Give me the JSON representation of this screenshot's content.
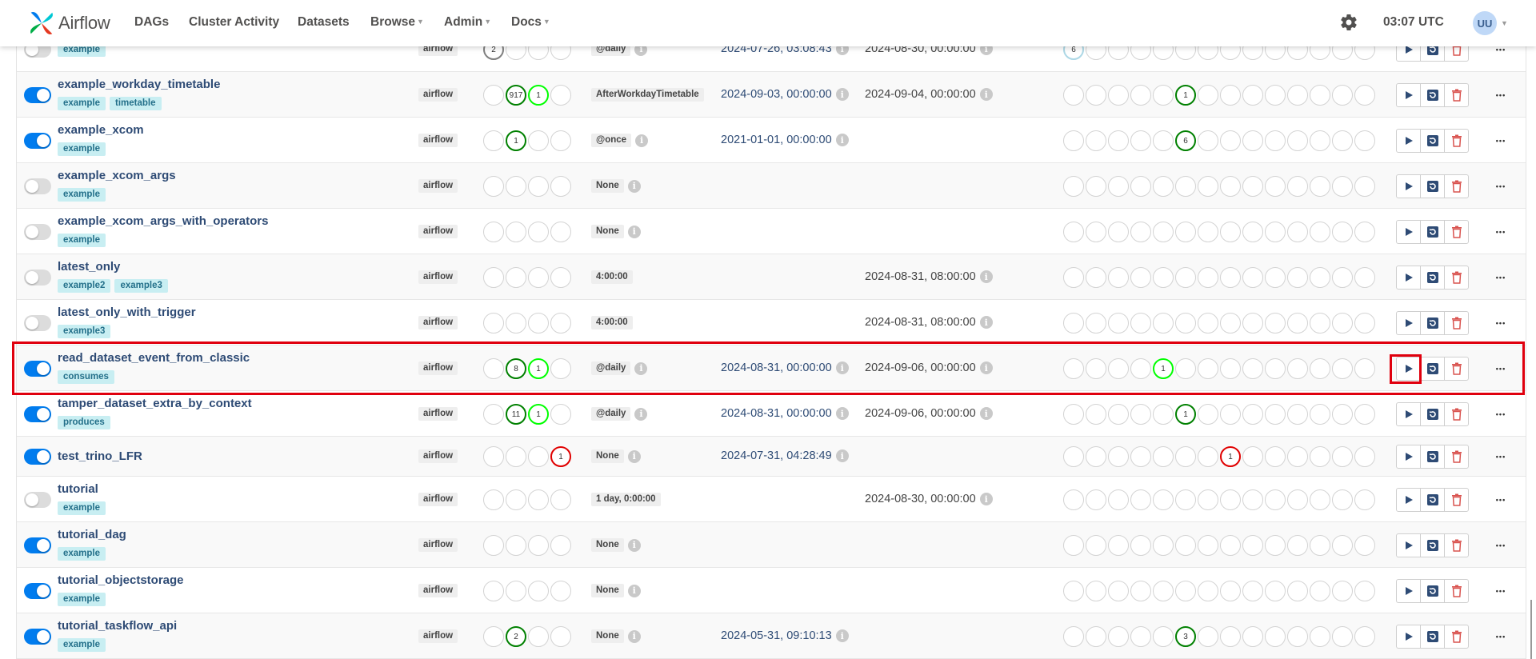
{
  "nav": {
    "brand": "Airflow",
    "items": [
      "DAGs",
      "Cluster Activity",
      "Datasets",
      "Browse",
      "Admin",
      "Docs"
    ],
    "time": "03:07 UTC",
    "user_initials": "UU"
  },
  "rows": [
    {
      "name": "",
      "tags": [
        "example"
      ],
      "owner": "airflow",
      "paused": true,
      "task_stats": [
        {
          "n": "2",
          "s": "queued"
        },
        {
          "n": "",
          "s": ""
        },
        {
          "n": "",
          "s": ""
        },
        {
          "n": "",
          "s": ""
        }
      ],
      "schedule": "@daily",
      "schedule_info": true,
      "last_run": "2024-07-26, 03:08:43",
      "next_run": "2024-08-30, 00:00:00",
      "runs": [
        {
          "n": "6",
          "s": "scheduled"
        }
      ]
    },
    {
      "name": "example_workday_timetable",
      "tags": [
        "example",
        "timetable"
      ],
      "owner": "airflow",
      "paused": false,
      "task_stats": [
        {
          "n": "",
          "s": ""
        },
        {
          "n": "917",
          "s": "success"
        },
        {
          "n": "1",
          "s": "running"
        },
        {
          "n": "",
          "s": ""
        }
      ],
      "schedule": "AfterWorkdayTimetable",
      "schedule_info": false,
      "last_run": "2024-09-03, 00:00:00",
      "next_run": "2024-09-04, 00:00:00",
      "runs": [
        {
          "n": "",
          "s": ""
        },
        {
          "n": "",
          "s": ""
        },
        {
          "n": "",
          "s": ""
        },
        {
          "n": "",
          "s": ""
        },
        {
          "n": "",
          "s": ""
        },
        {
          "n": "1",
          "s": "success"
        }
      ]
    },
    {
      "name": "example_xcom",
      "tags": [
        "example"
      ],
      "owner": "airflow",
      "paused": false,
      "task_stats": [
        {
          "n": "",
          "s": ""
        },
        {
          "n": "1",
          "s": "success"
        },
        {
          "n": "",
          "s": ""
        },
        {
          "n": "",
          "s": ""
        }
      ],
      "schedule": "@once",
      "schedule_info": true,
      "last_run": "2021-01-01, 00:00:00",
      "next_run": "",
      "runs": [
        {
          "n": "",
          "s": ""
        },
        {
          "n": "",
          "s": ""
        },
        {
          "n": "",
          "s": ""
        },
        {
          "n": "",
          "s": ""
        },
        {
          "n": "",
          "s": ""
        },
        {
          "n": "6",
          "s": "success"
        }
      ]
    },
    {
      "name": "example_xcom_args",
      "tags": [
        "example"
      ],
      "owner": "airflow",
      "paused": true,
      "task_stats": [],
      "schedule": "None",
      "schedule_info": true,
      "last_run": "",
      "next_run": "",
      "runs": []
    },
    {
      "name": "example_xcom_args_with_operators",
      "tags": [
        "example"
      ],
      "owner": "airflow",
      "paused": true,
      "task_stats": [],
      "schedule": "None",
      "schedule_info": true,
      "last_run": "",
      "next_run": "",
      "runs": []
    },
    {
      "name": "latest_only",
      "tags": [
        "example2",
        "example3"
      ],
      "owner": "airflow",
      "paused": true,
      "task_stats": [],
      "schedule": "4:00:00",
      "schedule_info": false,
      "last_run": "",
      "next_run": "2024-08-31, 08:00:00",
      "runs": []
    },
    {
      "name": "latest_only_with_trigger",
      "tags": [
        "example3"
      ],
      "owner": "airflow",
      "paused": true,
      "task_stats": [],
      "schedule": "4:00:00",
      "schedule_info": false,
      "last_run": "",
      "next_run": "2024-08-31, 08:00:00",
      "runs": []
    },
    {
      "name": "read_dataset_event_from_classic",
      "tags": [
        "consumes"
      ],
      "owner": "airflow",
      "paused": false,
      "task_stats": [
        {
          "n": "",
          "s": ""
        },
        {
          "n": "8",
          "s": "success"
        },
        {
          "n": "1",
          "s": "running"
        },
        {
          "n": "",
          "s": ""
        }
      ],
      "schedule": "@daily",
      "schedule_info": true,
      "last_run": "2024-08-31, 00:00:00",
      "next_run": "2024-09-06, 00:00:00",
      "runs": [
        {
          "n": "",
          "s": ""
        },
        {
          "n": "",
          "s": ""
        },
        {
          "n": "",
          "s": ""
        },
        {
          "n": "",
          "s": ""
        },
        {
          "n": "1",
          "s": "running"
        }
      ]
    },
    {
      "name": "tamper_dataset_extra_by_context",
      "tags": [
        "produces"
      ],
      "owner": "airflow",
      "paused": false,
      "task_stats": [
        {
          "n": "",
          "s": ""
        },
        {
          "n": "11",
          "s": "success"
        },
        {
          "n": "1",
          "s": "running"
        },
        {
          "n": "",
          "s": ""
        }
      ],
      "schedule": "@daily",
      "schedule_info": true,
      "last_run": "2024-08-31, 00:00:00",
      "next_run": "2024-09-06, 00:00:00",
      "runs": [
        {
          "n": "",
          "s": ""
        },
        {
          "n": "",
          "s": ""
        },
        {
          "n": "",
          "s": ""
        },
        {
          "n": "",
          "s": ""
        },
        {
          "n": "",
          "s": ""
        },
        {
          "n": "1",
          "s": "success"
        }
      ]
    },
    {
      "name": "test_trino_LFR",
      "tags": [],
      "owner": "airflow",
      "paused": false,
      "task_stats": [
        {
          "n": "",
          "s": ""
        },
        {
          "n": "",
          "s": ""
        },
        {
          "n": "",
          "s": ""
        },
        {
          "n": "1",
          "s": "failed"
        }
      ],
      "schedule": "None",
      "schedule_info": true,
      "last_run": "2024-07-31, 04:28:49",
      "next_run": "",
      "runs": [
        {
          "n": "",
          "s": ""
        },
        {
          "n": "",
          "s": ""
        },
        {
          "n": "",
          "s": ""
        },
        {
          "n": "",
          "s": ""
        },
        {
          "n": "",
          "s": ""
        },
        {
          "n": "",
          "s": ""
        },
        {
          "n": "",
          "s": ""
        },
        {
          "n": "1",
          "s": "failed"
        }
      ]
    },
    {
      "name": "tutorial",
      "tags": [
        "example"
      ],
      "owner": "airflow",
      "paused": true,
      "task_stats": [],
      "schedule": "1 day, 0:00:00",
      "schedule_info": false,
      "last_run": "",
      "next_run": "2024-08-30, 00:00:00",
      "runs": []
    },
    {
      "name": "tutorial_dag",
      "tags": [
        "example"
      ],
      "owner": "airflow",
      "paused": false,
      "task_stats": [],
      "schedule": "None",
      "schedule_info": true,
      "last_run": "",
      "next_run": "",
      "runs": []
    },
    {
      "name": "tutorial_objectstorage",
      "tags": [
        "example"
      ],
      "owner": "airflow",
      "paused": false,
      "task_stats": [],
      "schedule": "None",
      "schedule_info": true,
      "last_run": "",
      "next_run": "",
      "runs": []
    },
    {
      "name": "tutorial_taskflow_api",
      "tags": [
        "example"
      ],
      "owner": "airflow",
      "paused": false,
      "task_stats": [
        {
          "n": "",
          "s": ""
        },
        {
          "n": "2",
          "s": "success"
        },
        {
          "n": "",
          "s": ""
        },
        {
          "n": "",
          "s": ""
        }
      ],
      "schedule": "None",
      "schedule_info": true,
      "last_run": "2024-05-31, 09:10:13",
      "next_run": "",
      "runs": [
        {
          "n": "",
          "s": ""
        },
        {
          "n": "",
          "s": ""
        },
        {
          "n": "",
          "s": ""
        },
        {
          "n": "",
          "s": ""
        },
        {
          "n": "",
          "s": ""
        },
        {
          "n": "3",
          "s": "success"
        }
      ]
    }
  ],
  "icons": {
    "trigger": "play-icon",
    "refresh": "refresh-icon",
    "delete": "trash-icon",
    "more": "more-icon",
    "settings": "gear-icon"
  },
  "colors": {
    "toggle_on": "#017cee",
    "success": "#008000",
    "running": "#00ff00",
    "failed": "#e00000",
    "highlight": "#e0000e"
  }
}
